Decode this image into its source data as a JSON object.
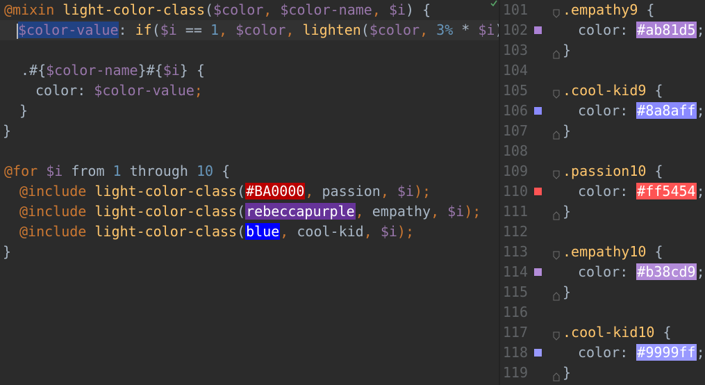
{
  "editor": {
    "lines": {
      "l1": {
        "kw": "@mixin",
        "fn": "light-color-class",
        "open": "(",
        "a1": "$color",
        "c1": ", ",
        "a2": "$color-name",
        "c2": ", ",
        "a3": "$i",
        "close": ") {"
      },
      "l2": {
        "var": "$color-value",
        "rest1": ": ",
        "ifkw": "if",
        "p1": "(",
        "v1": "$i",
        "eq": " == ",
        "n1": "1",
        "c1": ", ",
        "v2": "$color",
        "c2": ", ",
        "fn": "lighten",
        "p2": "(",
        "v3": "$color",
        "c3": ", ",
        "n2": "3%",
        "mul": " * ",
        "v4": "$i",
        "end": "));"
      },
      "l4": {
        "dot": ".#{",
        "v1": "$color-name",
        "mid": "}#{",
        "v2": "$i",
        "end": "} {"
      },
      "l5": {
        "prop": "color: ",
        "v": "$color-value",
        "semi": ";"
      },
      "l6": {
        "text": "}"
      },
      "l7": {
        "text": "}"
      },
      "l9": {
        "kw": "@for",
        "v": " $i ",
        "from": "from",
        "n1": " 1 ",
        "through": "through",
        "n2": " 10",
        "end": " {"
      },
      "l10": {
        "kw": "@include",
        "fn": " light-color-class",
        "open": "(",
        "chip": "#BA0000",
        "c1": ", ",
        "name": "passion",
        "c2": ", ",
        "v": "$i",
        "end": ");"
      },
      "l11": {
        "kw": "@include",
        "fn": " light-color-class",
        "open": "(",
        "chip": "rebeccapurple",
        "c1": ", ",
        "name": "empathy",
        "c2": ", ",
        "v": "$i",
        "end": ");"
      },
      "l12": {
        "kw": "@include",
        "fn": " light-color-class",
        "open": "(",
        "chip": "blue",
        "c1": ", ",
        "name": "cool-kid",
        "c2": ", ",
        "v": "$i",
        "end": ");"
      },
      "l13": {
        "text": "}"
      }
    },
    "chip_colors": {
      "passion": "#BA0000",
      "empathy": "#663399",
      "cool_kid": "#0000ff"
    }
  },
  "output": {
    "rows": [
      {
        "num": "101",
        "text_sel": ".empathy9",
        "text_tail": " {"
      },
      {
        "num": "102",
        "prop": "color: ",
        "hex": "#ab81d5",
        "semi": ";",
        "swatch": "#ab81d5"
      },
      {
        "num": "103",
        "brace": "}"
      },
      {
        "num": "104"
      },
      {
        "num": "105",
        "text_sel": ".cool-kid9",
        "text_tail": " {"
      },
      {
        "num": "106",
        "prop": "color: ",
        "hex": "#8a8aff",
        "semi": ";",
        "swatch": "#8a8aff"
      },
      {
        "num": "107",
        "brace": "}"
      },
      {
        "num": "108"
      },
      {
        "num": "109",
        "text_sel": ".passion10",
        "text_tail": " {"
      },
      {
        "num": "110",
        "prop": "color: ",
        "hex": "#ff5454",
        "semi": ";",
        "swatch": "#ff5454"
      },
      {
        "num": "111",
        "brace": "}"
      },
      {
        "num": "112"
      },
      {
        "num": "113",
        "text_sel": ".empathy10",
        "text_tail": " {"
      },
      {
        "num": "114",
        "prop": "color: ",
        "hex": "#b38cd9",
        "semi": ";",
        "swatch": "#b38cd9"
      },
      {
        "num": "115",
        "brace": "}"
      },
      {
        "num": "116"
      },
      {
        "num": "117",
        "text_sel": ".cool-kid10",
        "text_tail": " {"
      },
      {
        "num": "118",
        "prop": "color: ",
        "hex": "#9999ff",
        "semi": ";",
        "swatch": "#9999ff"
      },
      {
        "num": "119",
        "brace": "}"
      }
    ]
  }
}
